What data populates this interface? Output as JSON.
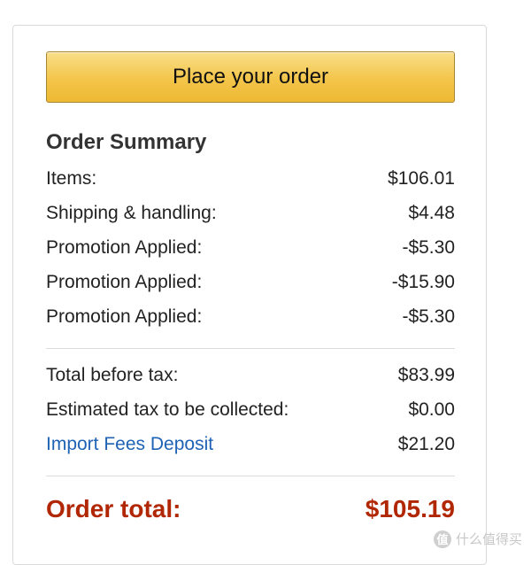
{
  "actions": {
    "place_order_label": "Place your order"
  },
  "summary": {
    "title": "Order Summary",
    "items": [
      {
        "label": "Items:",
        "value": "$106.01"
      },
      {
        "label": "Shipping & handling:",
        "value": "$4.48"
      },
      {
        "label": "Promotion Applied:",
        "value": "-$5.30"
      },
      {
        "label": "Promotion Applied:",
        "value": "-$15.90"
      },
      {
        "label": "Promotion Applied:",
        "value": "-$5.30"
      }
    ],
    "subtotals": [
      {
        "label": "Total before tax:",
        "value": "$83.99"
      },
      {
        "label": "Estimated tax to be collected:",
        "value": "$0.00"
      },
      {
        "label": "Import Fees Deposit",
        "value": "$21.20"
      }
    ],
    "order_total_label": "Order total:",
    "order_total_value": "$105.19"
  },
  "watermark": {
    "badge": "值",
    "text": "什么值得买"
  },
  "colors": {
    "button_gold": "#f3c54a",
    "total_red": "#b12704",
    "link_blue": "#1f63b5"
  }
}
